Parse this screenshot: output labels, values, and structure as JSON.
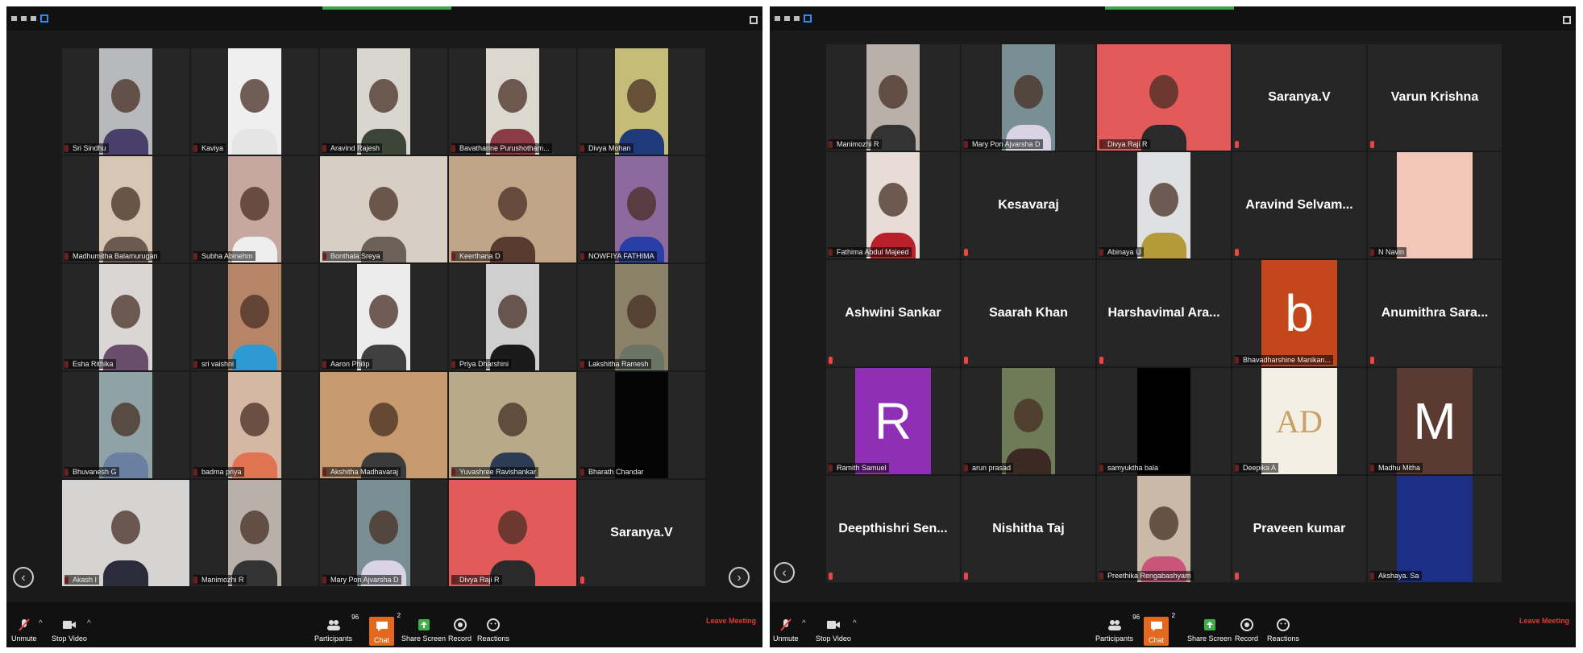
{
  "left": {
    "tiles": [
      {
        "name": "Sri Sindhu",
        "bg": "#b7b9bd",
        "body": "#4a3f6b",
        "type": "video"
      },
      {
        "name": "Kaviya",
        "bg": "#efefef",
        "body": "#e5e5e5",
        "type": "video"
      },
      {
        "name": "Aravind Rajesh",
        "bg": "#d9d6d0",
        "body": "#3c4638",
        "type": "video"
      },
      {
        "name": "Bavatharine Purushotham...",
        "bg": "#ddd8cf",
        "body": "#8a3b45",
        "type": "video"
      },
      {
        "name": "Divya Mohan",
        "bg": "#c5bc7a",
        "body": "#1f3a7a",
        "type": "video"
      },
      {
        "name": "Madhumitha Balamurugan",
        "bg": "#d8c6b5",
        "body": "#6a5a50",
        "type": "video"
      },
      {
        "name": "Subha Abinehm",
        "bg": "#c7a8a0",
        "body": "#eeeeee",
        "type": "video"
      },
      {
        "name": "Bonthala Sreya",
        "bg": "#d7cfc4",
        "body": "#6b6158",
        "type": "wide"
      },
      {
        "name": "Keerthana D",
        "bg": "#c2a487",
        "body": "#5a3a2e",
        "type": "wide"
      },
      {
        "name": "NOWFIYA FATHIMA",
        "bg": "#8c6aa0",
        "body": "#2a3ea8",
        "type": "video"
      },
      {
        "name": "Esha Rithika",
        "bg": "#d9d6d5",
        "body": "#6a4d6a",
        "type": "video"
      },
      {
        "name": "sri vaishni",
        "bg": "#b68467",
        "body": "#2e9ad3",
        "type": "video"
      },
      {
        "name": "Aaron Philip",
        "bg": "#ececec",
        "body": "#3f3f3f",
        "type": "video"
      },
      {
        "name": "Priya Dharshini",
        "bg": "#cfcfcf",
        "body": "#1a1a1a",
        "type": "video"
      },
      {
        "name": "Lakshitha Ramesh",
        "bg": "#8a8168",
        "body": "#6b7465",
        "type": "video"
      },
      {
        "name": "Bhuvanesh G",
        "bg": "#8fa2a6",
        "body": "#6b7fa0",
        "type": "video"
      },
      {
        "name": "badma priya",
        "bg": "#d6b7a4",
        "body": "#e07452",
        "type": "video"
      },
      {
        "name": "Akshitha Madhavaraj",
        "bg": "#c79a6e",
        "body": "#3b3b3b",
        "type": "wide"
      },
      {
        "name": "Yuvashree Ravishankar",
        "bg": "#b8a989",
        "body": "#2d3b55",
        "type": "wide"
      },
      {
        "name": "Bharath Chandar",
        "bg": "#050505",
        "body": "#050505",
        "type": "video"
      },
      {
        "name": "Akash I",
        "bg": "#d5d4d2",
        "body": "#2b2b3b",
        "type": "wide"
      },
      {
        "name": "Manimozhi R",
        "bg": "#b9b0a9",
        "body": "#333333",
        "type": "video"
      },
      {
        "name": "Mary Pon Ajvarsha D",
        "bg": "#7a8f93",
        "body": "#d9d4e5",
        "type": "video"
      },
      {
        "name": "Divya Raji R",
        "bg": "#e35a5a",
        "body": "#2a2a2a",
        "type": "wide"
      },
      {
        "name": "",
        "label": "Saranya.V",
        "type": "text"
      }
    ],
    "toolbar": {
      "unmute": "Unmute",
      "stop_video": "Stop Video",
      "participants": "Participants",
      "participants_count": "96",
      "chat": "Chat",
      "chat_count": "2",
      "share_screen": "Share Screen",
      "record": "Record",
      "reactions": "Reactions",
      "leave": "Leave Meeting"
    }
  },
  "right": {
    "tiles": [
      {
        "name": "Manimozhi R",
        "bg": "#b9b0a9",
        "body": "#333333",
        "type": "video"
      },
      {
        "name": "Mary Pon Ajvarsha D",
        "bg": "#7a8f93",
        "body": "#d9d4e5",
        "type": "video"
      },
      {
        "name": "Divya Raji R",
        "bg": "#e35a5a",
        "body": "#2a2a2a",
        "type": "wide"
      },
      {
        "name": "",
        "label": "Saranya.V",
        "type": "text"
      },
      {
        "name": "",
        "label": "Varun Krishna",
        "type": "text"
      },
      {
        "name": "Fathima Abdul Majeed",
        "bg": "#e8dcd6",
        "body": "#b8202a",
        "type": "video"
      },
      {
        "name": "",
        "label": "Kesavaraj",
        "type": "text"
      },
      {
        "name": "Abinaya U",
        "bg": "#dfe0e2",
        "body": "#b59a3a",
        "type": "video"
      },
      {
        "name": "",
        "label": "Aravind Selvam...",
        "type": "text"
      },
      {
        "name": "N Navin",
        "avatar": "#f2c6b8",
        "letter": "",
        "type": "avatar"
      },
      {
        "name": "",
        "label": "Ashwini Sankar",
        "type": "text"
      },
      {
        "name": "",
        "label": "Saarah Khan",
        "type": "text"
      },
      {
        "name": "",
        "label": "Harshavimal Ara...",
        "type": "text"
      },
      {
        "name": "Bhavadharshine Manikan...",
        "avatar": "#c4461b",
        "letter": "b",
        "type": "avatar"
      },
      {
        "name": "",
        "label": "Anumithra Sara...",
        "type": "text"
      },
      {
        "name": "Ramith Samuel",
        "avatar": "#8e2fb6",
        "letter": "R",
        "type": "avatar"
      },
      {
        "name": "arun prasad",
        "bg": "#6f7a56",
        "body": "#3a2a22",
        "type": "video"
      },
      {
        "name": "samyuktha bala",
        "bg": "#000000",
        "body": "#000000",
        "type": "video"
      },
      {
        "name": "Deepika A",
        "avatar": "#f4efe5",
        "letter": "AD",
        "type": "avatar",
        "dark": true
      },
      {
        "name": "Madhu Mitha",
        "avatar": "#5a3a31",
        "letter": "M",
        "type": "avatar"
      },
      {
        "name": "",
        "label": "Deepthishri Sen...",
        "type": "text"
      },
      {
        "name": "",
        "label": "Nishitha Taj",
        "type": "text"
      },
      {
        "name": "Preethika Rengabashyam",
        "bg": "#c9b9a6",
        "body": "#c9567a",
        "type": "video"
      },
      {
        "name": "",
        "label": "Praveen kumar",
        "type": "text"
      },
      {
        "name": "Akshaya. Sa",
        "avatar": "#1b2f86",
        "letter": "",
        "type": "avatar"
      }
    ],
    "toolbar": {
      "unmute": "Unmute",
      "stop_video": "Stop Video",
      "participants": "Participants",
      "participants_count": "96",
      "chat": "Chat",
      "chat_count": "2",
      "share_screen": "Share Screen",
      "record": "Record",
      "reactions": "Reactions",
      "leave": "Leave Meeting"
    }
  }
}
